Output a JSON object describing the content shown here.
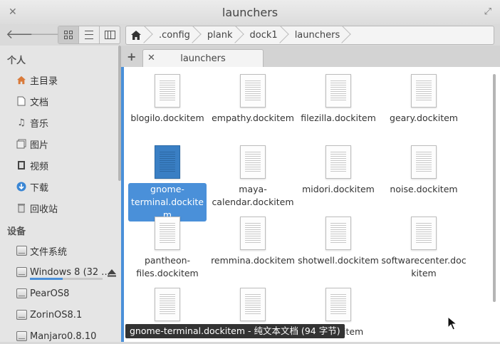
{
  "window": {
    "title": "launchers"
  },
  "toolbar": {
    "back_icon": "arrow-left-icon",
    "forward_icon": "arrow-right-icon",
    "views": [
      "icon-view",
      "list-view",
      "column-view"
    ]
  },
  "breadcrumb": {
    "items": [
      ".config",
      "plank",
      "dock1",
      "launchers"
    ]
  },
  "sidebar": {
    "personal_header": "个人",
    "personal": [
      {
        "label": "主目录",
        "icon": "home-icon"
      },
      {
        "label": "文档",
        "icon": "document-icon"
      },
      {
        "label": "音乐",
        "icon": "music-icon"
      },
      {
        "label": "图片",
        "icon": "pictures-icon"
      },
      {
        "label": "视频",
        "icon": "video-icon"
      },
      {
        "label": "下载",
        "icon": "download-icon"
      },
      {
        "label": "回收站",
        "icon": "trash-icon"
      }
    ],
    "devices_header": "设备",
    "devices": [
      {
        "label": "文件系统"
      },
      {
        "label": "Windows 8 (32 ..."
      },
      {
        "label": "PearOS8"
      },
      {
        "label": "ZorinOS8.1"
      },
      {
        "label": "Manjaro0.8.10"
      }
    ]
  },
  "tabs": [
    {
      "label": "launchers"
    }
  ],
  "files": [
    {
      "name": "blogilo.dockitem"
    },
    {
      "name": "empathy.dockitem"
    },
    {
      "name": "filezilla.dockitem"
    },
    {
      "name": "geary.dockitem"
    },
    {
      "name": "gnome-terminal.dockitem",
      "selected": true
    },
    {
      "name": "maya-calendar.dockitem"
    },
    {
      "name": "midori.dockitem"
    },
    {
      "name": "noise.dockitem"
    },
    {
      "name": "pantheon-files.dockitem"
    },
    {
      "name": "remmina.dockitem"
    },
    {
      "name": "shotwell.dockitem"
    },
    {
      "name": "softwarecenter.dockitem"
    },
    {
      "name": ""
    },
    {
      "name": ""
    },
    {
      "name": "…dockitem"
    }
  ],
  "tooltip": "gnome-terminal.dockitem - 纯文本文档 (94 字节)",
  "colors": {
    "accent": "#4a90d9",
    "selected_file": "#3a7fc4"
  }
}
